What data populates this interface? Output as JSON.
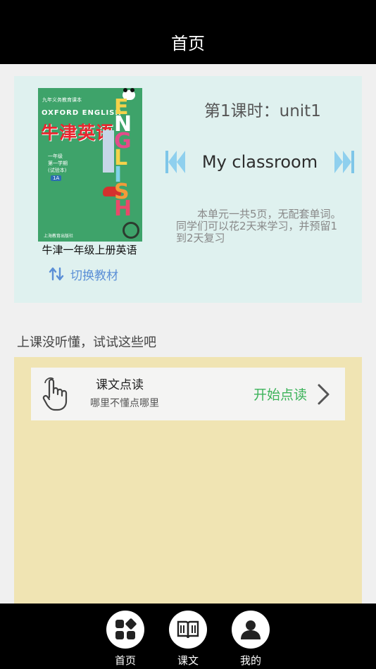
{
  "header": {
    "title": "首页"
  },
  "book": {
    "cover": {
      "publisher_line": "九年义务教育课本",
      "series": "OXFORD ENGLISH",
      "title": "牛津英语",
      "letters": [
        "E",
        "N",
        "G",
        "L",
        "I",
        "S",
        "H"
      ],
      "grade_lines": [
        "一年级",
        "第一学期",
        "(试验本)"
      ],
      "badge": "1A",
      "press": "上海教育出版社"
    },
    "name": "牛津一年级上册英语",
    "switch_label": "切换教材"
  },
  "lesson": {
    "number_label": "第1课时：unit1",
    "title": "My classroom",
    "description": "本单元一共5页，无配套单词。同学们可以花2天来学习，并预留1到2天复习"
  },
  "practice": {
    "hint": "上课没听懂，试试这些吧",
    "items": [
      {
        "title": "课文点读",
        "subtitle": "哪里不懂点哪里",
        "action": "开始点读"
      }
    ]
  },
  "tabbar": {
    "tabs": [
      {
        "label": "首页",
        "icon": "grid-icon"
      },
      {
        "label": "课文",
        "icon": "book-icon"
      },
      {
        "label": "我的",
        "icon": "person-icon"
      }
    ]
  },
  "colors": {
    "accent_green": "#3cb35a",
    "accent_blue": "#5b8fd6",
    "card_bg": "#dff1ef",
    "panel_bg": "#f0e4b3"
  }
}
